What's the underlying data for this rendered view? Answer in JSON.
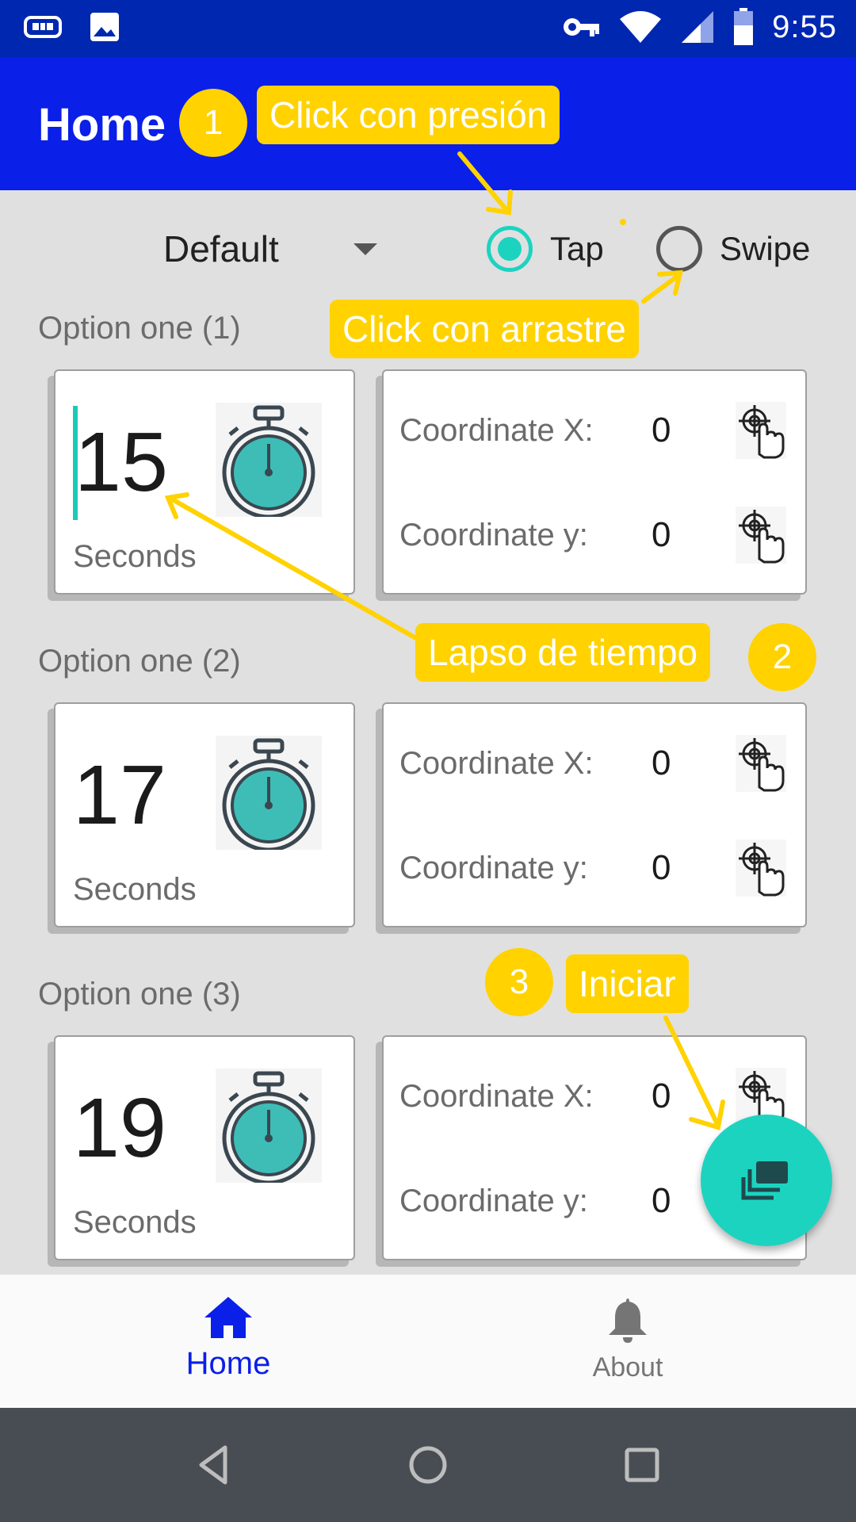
{
  "status_bar": {
    "time": "9:55",
    "icons": [
      "keyboard-icon",
      "image-icon",
      "vpn-key-icon",
      "wifi-icon",
      "cell-signal-icon",
      "battery-icon"
    ]
  },
  "app_bar": {
    "title": "Home"
  },
  "controls": {
    "profile": {
      "value": "Default"
    },
    "mode": {
      "options": [
        {
          "label": "Tap",
          "checked": true
        },
        {
          "label": "Swipe",
          "checked": false
        }
      ]
    }
  },
  "options": [
    {
      "label": "Option one (1)",
      "seconds": "15",
      "unit": "Seconds",
      "x_label": "Coordinate X:",
      "x_value": "0",
      "y_label": "Coordinate y:",
      "y_value": "0"
    },
    {
      "label": "Option one (2)",
      "seconds": "17",
      "unit": "Seconds",
      "x_label": "Coordinate X:",
      "x_value": "0",
      "y_label": "Coordinate y:",
      "y_value": "0"
    },
    {
      "label": "Option one (3)",
      "seconds": "19",
      "unit": "Seconds",
      "x_label": "Coordinate X:",
      "x_value": "0",
      "y_label": "Coordinate y:",
      "y_value": "0"
    }
  ],
  "bottom_nav": {
    "items": [
      {
        "label": "Home",
        "icon": "home-icon",
        "active": true
      },
      {
        "label": "About",
        "icon": "bell-icon",
        "active": false
      }
    ]
  },
  "annotations": {
    "callouts": [
      "Click con presión",
      "Click con arrastre",
      "Lapso de tiempo",
      "Iniciar"
    ],
    "badges": [
      "1",
      "2",
      "3"
    ]
  },
  "colors": {
    "app_bar": "#0a1fe8",
    "status_bar": "#0027b0",
    "accent": "#1cd3c0",
    "annotation": "#ffd200"
  }
}
